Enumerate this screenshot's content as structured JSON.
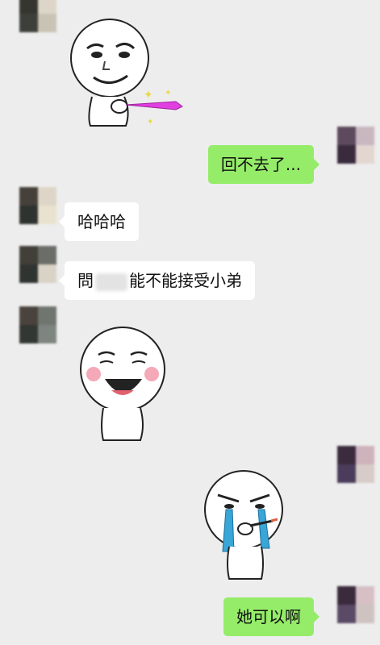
{
  "colors": {
    "background": "#ededed",
    "bubble_sent": "#95ec69",
    "bubble_received": "#ffffff"
  },
  "messages": [
    {
      "side": "left",
      "type": "sticker",
      "sticker": "smug-face-with-pink-sword"
    },
    {
      "side": "right",
      "type": "text",
      "text": "回不去了..."
    },
    {
      "side": "left",
      "type": "text",
      "text": "哈哈哈"
    },
    {
      "side": "left",
      "type": "text",
      "text_before": "問",
      "text_after": "能不能接受小弟"
    },
    {
      "side": "left",
      "type": "sticker",
      "sticker": "laughing-blushing-face"
    },
    {
      "side": "right",
      "type": "sticker",
      "sticker": "crying-face-with-cigarette"
    },
    {
      "side": "right",
      "type": "text",
      "text": "她可以啊"
    }
  ]
}
